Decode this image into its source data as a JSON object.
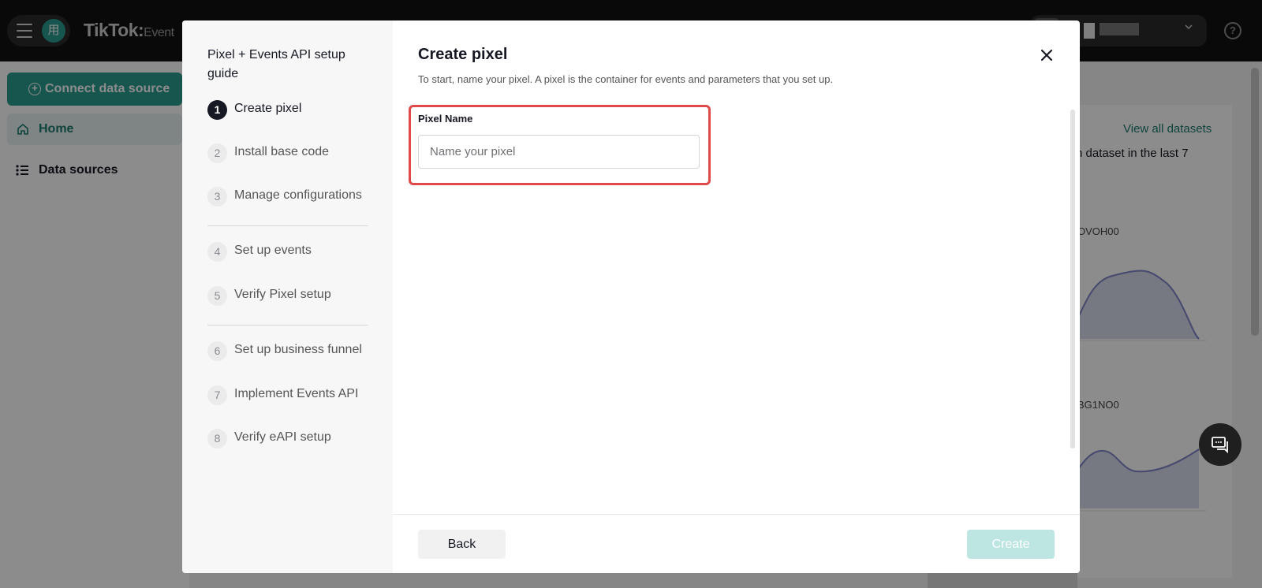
{
  "app": {
    "logo_text": "TikTok:",
    "logo_sub": "Event",
    "avatar_char": "用",
    "connect_label": "Connect data source",
    "nav_home": "Home",
    "nav_data_sources": "Data sources",
    "view_all": "View all datasets",
    "frag_dataset": "n dataset in the last 7",
    "frag_id1": "OVOH00",
    "frag_id2": "BG1NO0",
    "help_symbol": "?",
    "accent_color": "#2a9d8f"
  },
  "guide": {
    "title": "Pixel + Events API setup guide",
    "steps": [
      {
        "num": "1",
        "label": "Create pixel",
        "active": true
      },
      {
        "num": "2",
        "label": "Install base code"
      },
      {
        "num": "3",
        "label": "Manage configurations"
      },
      {
        "num": "4",
        "label": "Set up events"
      },
      {
        "num": "5",
        "label": "Verify Pixel setup"
      },
      {
        "num": "6",
        "label": "Set up business funnel"
      },
      {
        "num": "7",
        "label": "Implement Events API"
      },
      {
        "num": "8",
        "label": "Verify eAPI setup"
      }
    ]
  },
  "dialog": {
    "title": "Create pixel",
    "description": "To start, name your pixel. A pixel is the container for events and parameters that you set up.",
    "field_label": "Pixel Name",
    "field_placeholder": "Name your pixel",
    "field_value": "",
    "back_label": "Back",
    "create_label": "Create",
    "highlight_color": "#e04a4a"
  },
  "icons": {
    "menu": "hamburger-icon",
    "home": "home-icon",
    "data_sources": "list-icon",
    "help": "help-icon",
    "close": "close-icon",
    "chat": "chat-icon",
    "dropdown": "chevron-down-icon"
  }
}
